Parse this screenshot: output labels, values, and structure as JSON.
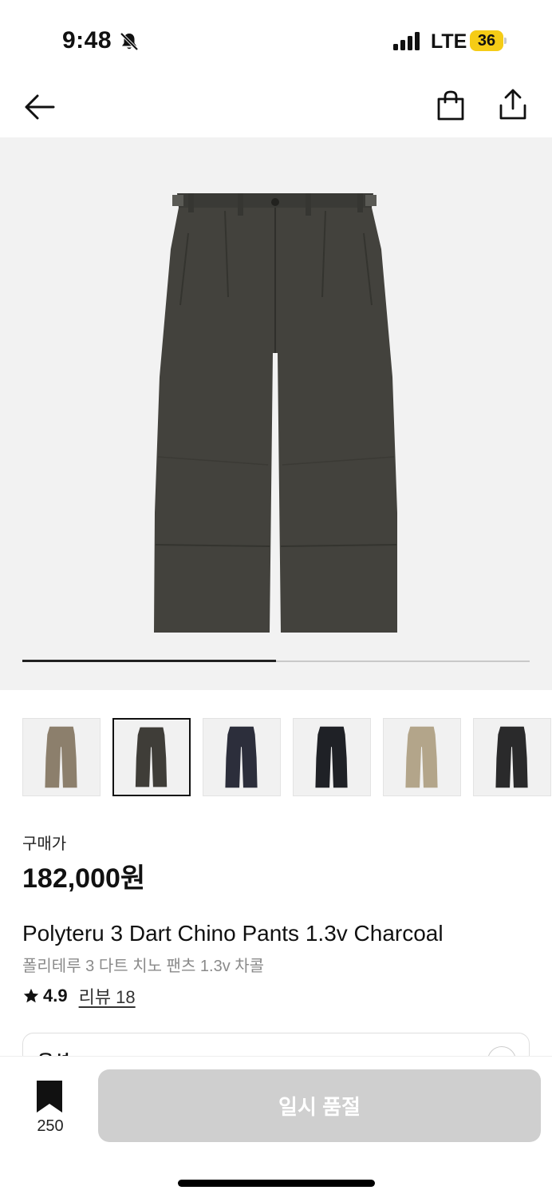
{
  "status_bar": {
    "time": "9:48",
    "network": "LTE",
    "battery": "36",
    "icons": [
      "bell-slash-icon",
      "signal-bars-icon"
    ]
  },
  "nav": {
    "icons": [
      "arrow-left-icon",
      "shopping-bag-icon",
      "share-icon"
    ]
  },
  "gallery": {
    "progress": 0.5
  },
  "thumbnails": [
    {
      "color": "#8c7f6c",
      "selected": false
    },
    {
      "color": "#3f3d38",
      "selected": true
    },
    {
      "color": "#2c2e3b",
      "selected": false
    },
    {
      "color": "#1f2126",
      "selected": false
    },
    {
      "color": "#b3a58a",
      "selected": false
    },
    {
      "color": "#2a2a2b",
      "selected": false
    }
  ],
  "product": {
    "price_label": "구매가",
    "price": "182,000원",
    "name_en": "Polyteru 3 Dart Chino Pants 1.3v Charcoal",
    "name_ko": "폴리테루 3 다트 치노 팬츠 1.3v 차콜",
    "rating": "4.9",
    "review_text": "리뷰 18"
  },
  "options": {
    "label": "옵션"
  },
  "bottom_bar": {
    "bookmark_count": "250",
    "button_label": "일시 품절"
  },
  "colors": {
    "accent_battery": "#f5cc16",
    "disabled_button": "#cfcfcf",
    "gallery_bg": "#f2f2f2"
  }
}
